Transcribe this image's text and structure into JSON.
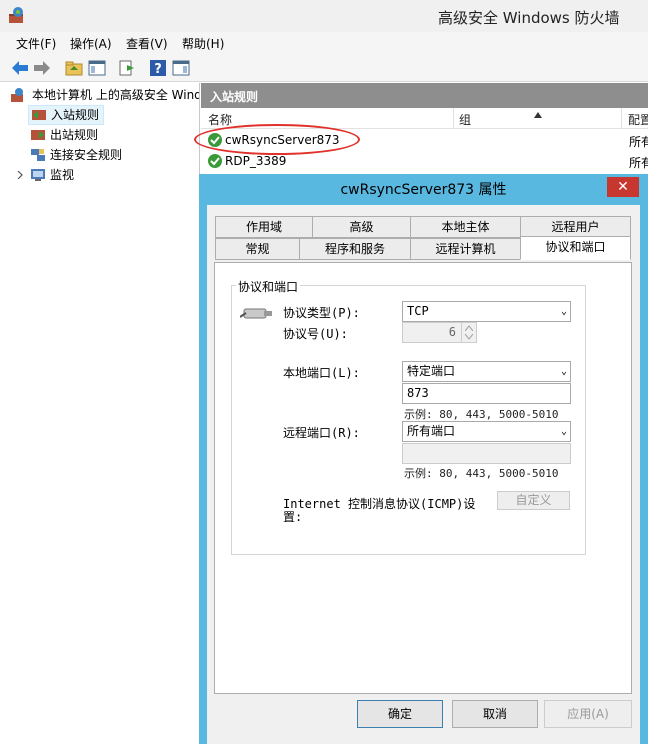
{
  "window": {
    "title": "高级安全 Windows 防火墙"
  },
  "menu": [
    {
      "label": "文件(F)"
    },
    {
      "label": "操作(A)"
    },
    {
      "label": "查看(V)"
    },
    {
      "label": "帮助(H)"
    }
  ],
  "tree": {
    "root": "本地计算机 上的高级安全 Windows 防火墙",
    "items": [
      {
        "label": "入站规则"
      },
      {
        "label": "出站规则"
      },
      {
        "label": "连接安全规则"
      },
      {
        "label": "监视"
      }
    ]
  },
  "list": {
    "header": "入站规则",
    "columns": [
      "名称",
      "组",
      "配置"
    ],
    "rows": [
      {
        "name": "cwRsyncServer873",
        "extra": "所有"
      },
      {
        "name": "RDP_3389",
        "extra": "所有"
      }
    ]
  },
  "dialog": {
    "title": "cwRsyncServer873 属性",
    "close_icon": "close-icon",
    "tabs_row1": [
      "作用域",
      "高级",
      "本地主体",
      "远程用户"
    ],
    "tabs_row2": [
      "常规",
      "程序和服务",
      "远程计算机",
      "协议和端口"
    ],
    "active_tab": "协议和端口",
    "group_title": "协议和端口",
    "protocol_type_label": "协议类型(P):",
    "protocol_type_value": "TCP",
    "protocol_number_label": "协议号(U):",
    "protocol_number_value": "6",
    "local_port_label": "本地端口(L):",
    "local_port_value": "特定端口",
    "local_port_text": "873",
    "local_port_hint": "示例: 80, 443, 5000-5010",
    "remote_port_label": "远程端口(R):",
    "remote_port_value": "所有端口",
    "remote_port_text": "",
    "remote_port_hint": "示例: 80, 443, 5000-5010",
    "icmp_label_line1": "Internet 控制消息协议(ICMP)设",
    "icmp_label_line2": "置:",
    "customize_button": "自定义",
    "ok_button": "确定",
    "cancel_button": "取消",
    "apply_button": "应用(A)"
  },
  "colors": {
    "dialog_frame": "#59b8e0",
    "close_button": "#c7372f",
    "highlight": "#e0312a",
    "list_header": "#8e8e8e"
  }
}
